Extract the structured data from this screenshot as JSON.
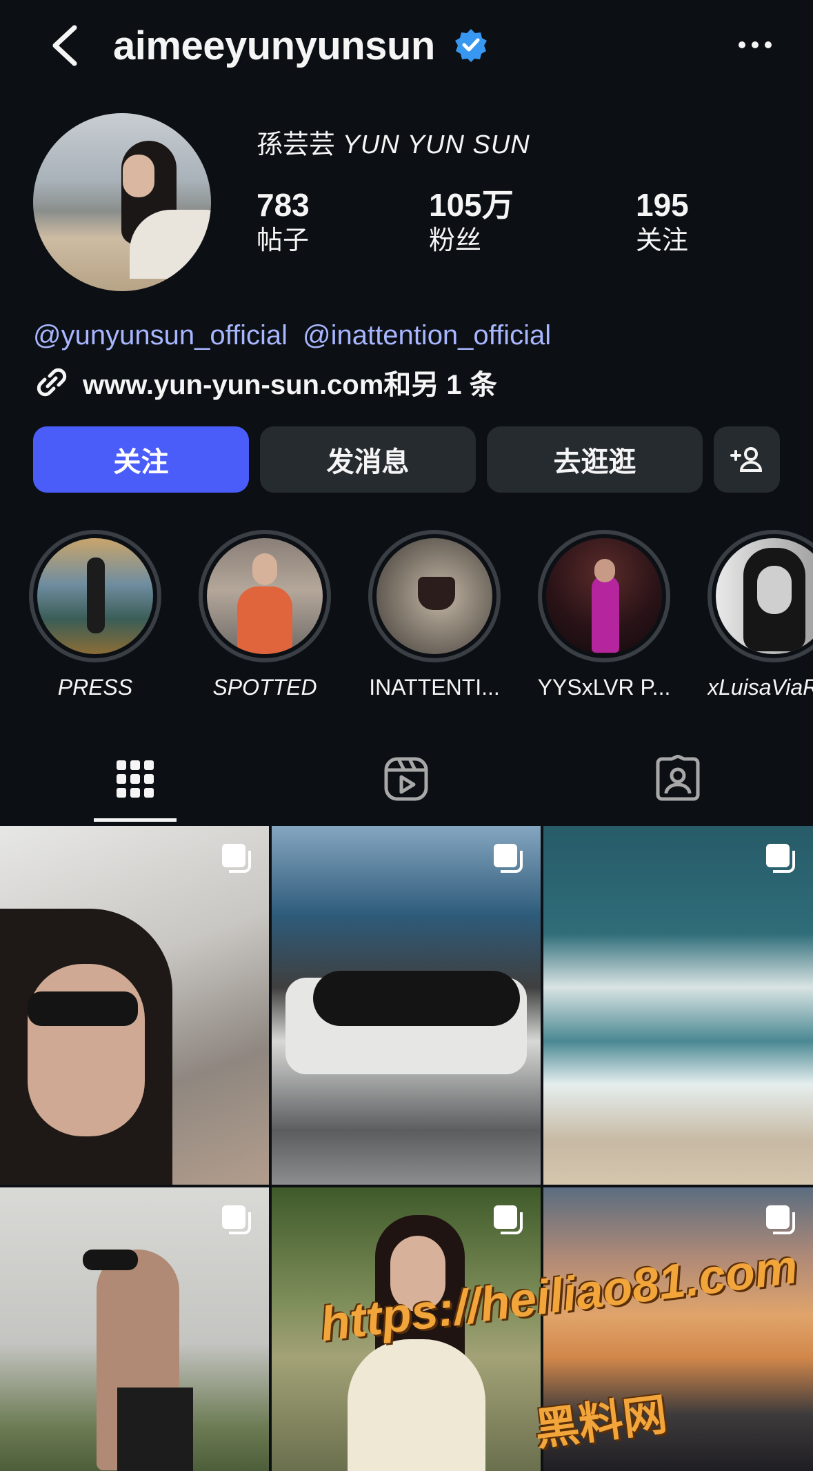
{
  "header": {
    "username": "aimeeyunyunsun",
    "icons": [
      "back-chevron-icon",
      "verified-badge-icon",
      "more-icon"
    ]
  },
  "profile": {
    "display_name_cn": "孫芸芸",
    "display_name_latin": "YUN YUN SUN",
    "stats": [
      {
        "value": "783",
        "label": "帖子"
      },
      {
        "value": "105万",
        "label": "粉丝"
      },
      {
        "value": "195",
        "label": "关注"
      }
    ],
    "mentions": [
      "@yunyunsun_official",
      "@inattention_official"
    ],
    "link_text": "www.yun-yun-sun.com和另 1 条"
  },
  "buttons": {
    "follow": "关注",
    "message": "发消息",
    "shop": "去逛逛"
  },
  "highlights": [
    {
      "label": "PRESS"
    },
    {
      "label": "SPOTTED"
    },
    {
      "label": "INATTENTI..."
    },
    {
      "label": "YYSxLVR P..."
    },
    {
      "label": "xLuisaViaRo"
    }
  ],
  "tabs": [
    "grid-icon",
    "reels-icon",
    "tagged-icon"
  ],
  "watermark": {
    "url": "https://heiliao81.com",
    "name": "黑料网"
  },
  "colors": {
    "background": "#0c1014",
    "primary_button": "#4a5df9",
    "secondary_button": "#262b30",
    "mention": "#a8b6ff",
    "verified": "#3897f0"
  }
}
